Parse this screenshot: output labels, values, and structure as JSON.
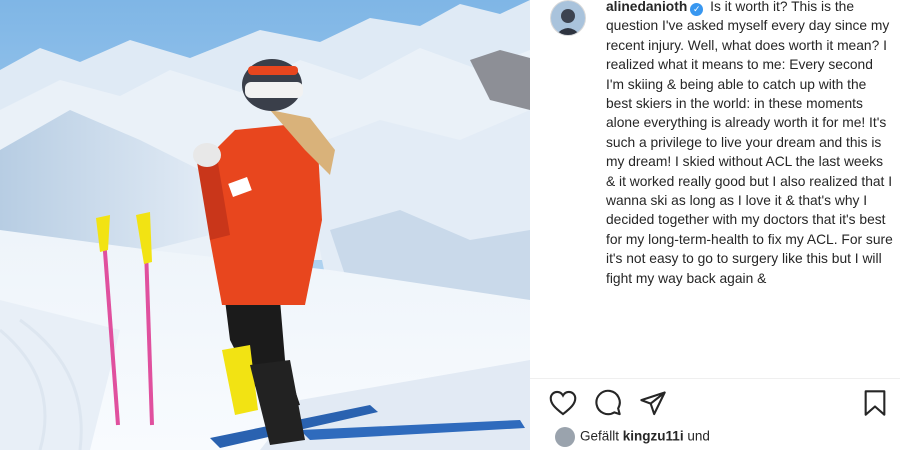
{
  "post": {
    "username": "alinedanioth",
    "verified_mark": "✓",
    "caption": "Is it worth it? This is the question I've asked myself every day since my recent injury. Well, what does worth it mean? I realized what it means to me: Every second I'm skiing & being able to catch up with the best skiers in the world: in these moments alone everything is already worth it for me! It's such a privilege to live your dream and this is my dream! I skied without ACL the last weeks & it worked really good but I also realized that I wanna ski as long as I love it & that's why I decided together with my doctors that it's best for my long-term-health to fix my ACL. For sure it's not easy to go to surgery like this but I will fight my way back again &"
  },
  "likes": {
    "prefix": "Gefällt",
    "user": "kingzu11i",
    "suffix": "und"
  },
  "icons": {
    "like": "heart-icon",
    "comment": "comment-icon",
    "share": "paper-plane-icon",
    "save": "bookmark-icon"
  },
  "colors": {
    "text": "#262626",
    "verified": "#3897f0",
    "jacket": "#e8461e",
    "pole": "#f2e313"
  }
}
